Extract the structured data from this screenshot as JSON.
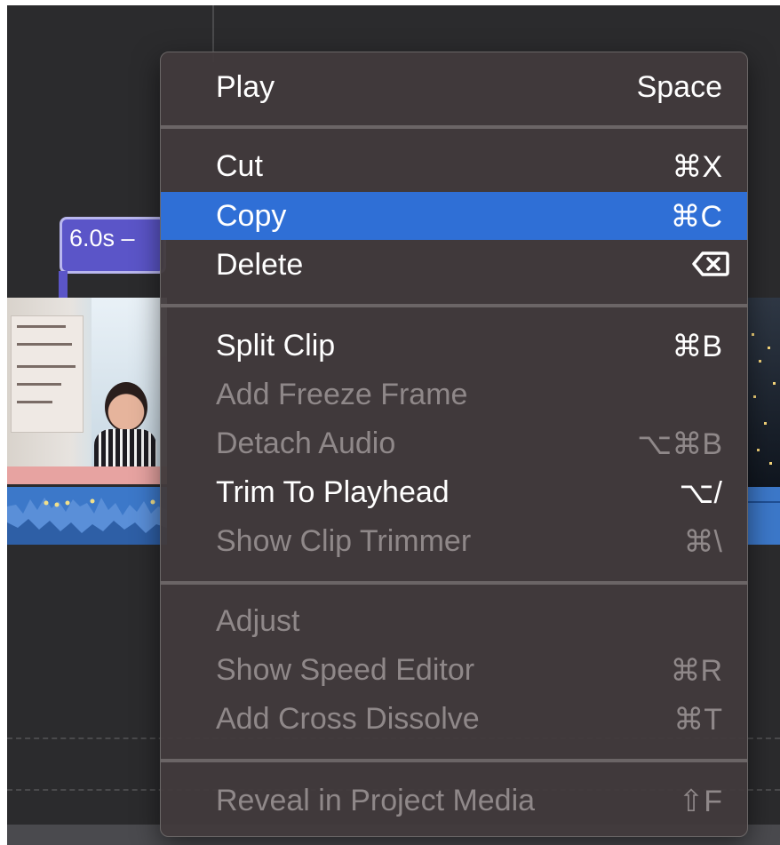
{
  "timeline": {
    "clip_duration_label": "6.0s –"
  },
  "context_menu": {
    "items": [
      {
        "label": "Play",
        "shortcut": "Space",
        "enabled": true
      },
      {
        "label": "Cut",
        "shortcut": "⌘X",
        "enabled": true
      },
      {
        "label": "Copy",
        "shortcut": "⌘C",
        "enabled": true,
        "highlighted": true
      },
      {
        "label": "Delete",
        "shortcut_icon": "delete-key-icon",
        "enabled": true
      },
      {
        "label": "Split Clip",
        "shortcut": "⌘B",
        "enabled": true
      },
      {
        "label": "Add Freeze Frame",
        "shortcut": "",
        "enabled": false
      },
      {
        "label": "Detach Audio",
        "shortcut": "⌥⌘B",
        "enabled": false
      },
      {
        "label": "Trim To Playhead",
        "shortcut": "⌥/",
        "enabled": true
      },
      {
        "label": "Show Clip Trimmer",
        "shortcut": "⌘\\",
        "enabled": false
      },
      {
        "label": "Adjust",
        "shortcut": "",
        "enabled": false
      },
      {
        "label": "Show Speed Editor",
        "shortcut": "⌘R",
        "enabled": false
      },
      {
        "label": "Add Cross Dissolve",
        "shortcut": "⌘T",
        "enabled": false
      },
      {
        "label": "Reveal in Project Media",
        "shortcut": "⇧F",
        "enabled": false
      }
    ]
  },
  "colors": {
    "highlight": "#2f6fd6",
    "menu_background": "#423a3c",
    "disabled_text": "#8f8889",
    "clip_label": "#5b55c8",
    "audio_waveform": "#3c78c9"
  }
}
